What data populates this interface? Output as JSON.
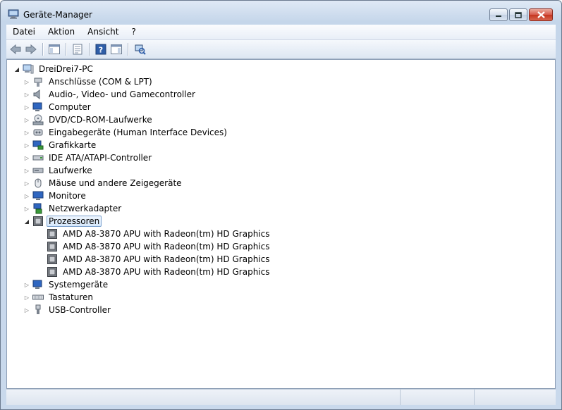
{
  "window": {
    "title": "Geräte-Manager"
  },
  "menu": [
    "Datei",
    "Aktion",
    "Ansicht",
    "?"
  ],
  "toolbar": {
    "icons": [
      "back-icon",
      "forward-icon",
      "show-hide-console-tree-icon",
      "properties-icon",
      "help-icon",
      "action-pane-icon",
      "scan-hardware-icon"
    ]
  },
  "tree": {
    "root": "DreiDrei7-PC",
    "categories": [
      {
        "label": "Anschlüsse (COM & LPT)",
        "icon": "port-icon"
      },
      {
        "label": "Audio-, Video- und Gamecontroller",
        "icon": "speaker-icon"
      },
      {
        "label": "Computer",
        "icon": "computer-icon"
      },
      {
        "label": "DVD/CD-ROM-Laufwerke",
        "icon": "dvd-drive-icon"
      },
      {
        "label": "Eingabegeräte (Human Interface Devices)",
        "icon": "hid-icon"
      },
      {
        "label": "Grafikkarte",
        "icon": "display-adapter-icon"
      },
      {
        "label": "IDE ATA/ATAPI-Controller",
        "icon": "ide-controller-icon"
      },
      {
        "label": "Laufwerke",
        "icon": "disk-drive-icon"
      },
      {
        "label": "Mäuse und andere Zeigegeräte",
        "icon": "mouse-icon"
      },
      {
        "label": "Monitore",
        "icon": "monitor-icon"
      },
      {
        "label": "Netzwerkadapter",
        "icon": "network-adapter-icon"
      }
    ],
    "processors": {
      "label": "Prozessoren",
      "children": [
        "AMD A8-3870 APU with Radeon(tm) HD Graphics",
        "AMD A8-3870 APU with Radeon(tm) HD Graphics",
        "AMD A8-3870 APU with Radeon(tm) HD Graphics",
        "AMD A8-3870 APU with Radeon(tm) HD Graphics"
      ]
    },
    "after": [
      {
        "label": "Systemgeräte",
        "icon": "system-devices-icon"
      },
      {
        "label": "Tastaturen",
        "icon": "keyboard-icon"
      },
      {
        "label": "USB-Controller",
        "icon": "usb-icon"
      }
    ]
  },
  "colors": {
    "selection_border": "#7da2ce",
    "title_gradient_top": "#dfe9f5",
    "close_red": "#c43520"
  }
}
